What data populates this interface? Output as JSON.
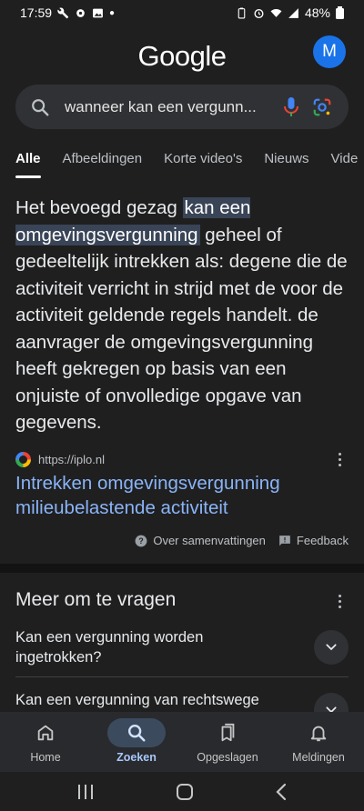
{
  "status": {
    "time": "17:59",
    "battery": "48%"
  },
  "header": {
    "logo": "Google",
    "avatar_letter": "M"
  },
  "search": {
    "query": "wanneer kan een vergunn..."
  },
  "tabs": [
    "Alle",
    "Afbeeldingen",
    "Korte video's",
    "Nieuws",
    "Vide"
  ],
  "snippet": {
    "before": "Het bevoegd gezag ",
    "highlight": "kan een omgevingsvergunning",
    "after": " geheel of gedeeltelijk intrekken als: degene die de activiteit verricht in strijd met de voor de activiteit geldende regels handelt. de aanvrager de omgevingsvergunning heeft gekregen op basis van een onjuiste of onvolledige opgave van gegevens."
  },
  "source": {
    "url": "https://iplo.nl"
  },
  "result": {
    "title": "Intrekken omgevingsvergunning milieubelastende activiteit"
  },
  "footer": {
    "about": "Over samenvattingen",
    "feedback": "Feedback"
  },
  "paa": {
    "title": "Meer om te vragen",
    "questions": [
      "Kan een vergunning worden ingetrokken?",
      "Kan een vergunning van rechtswege"
    ]
  },
  "nav": {
    "home": "Home",
    "search": "Zoeken",
    "saved": "Opgeslagen",
    "notifications": "Meldingen"
  }
}
